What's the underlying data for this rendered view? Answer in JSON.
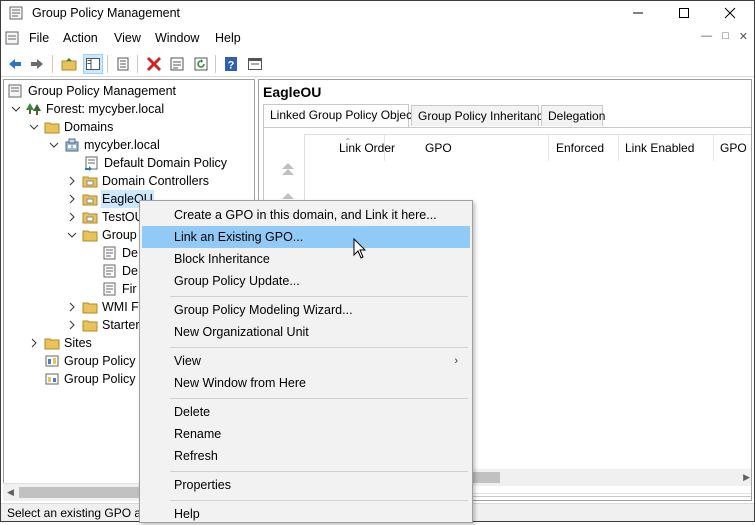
{
  "window": {
    "title": "Group Policy Management",
    "controls": [
      "minimize",
      "maximize",
      "close"
    ]
  },
  "menubar": {
    "items": [
      "File",
      "Action",
      "View",
      "Window",
      "Help"
    ]
  },
  "toolbar": {
    "icons": [
      "back-icon",
      "forward-icon",
      "up-folder-icon",
      "show-hide-tree-icon",
      "properties-icon",
      "delete-icon",
      "export-list-icon",
      "refresh-icon",
      "help-icon",
      "console-icon"
    ]
  },
  "tree": {
    "root": "Group Policy Management",
    "forest": "Forest: mycyber.local",
    "domains": "Domains",
    "domain": "mycyber.local",
    "default_domain_policy": "Default Domain Policy",
    "domain_controllers": "Domain Controllers",
    "eagle_ou": "EagleOU",
    "test_ou": "TestOU",
    "group_policy_objects": "Group",
    "gpo_child_1": "De",
    "gpo_child_2": "De",
    "gpo_child_3": "Fir",
    "wmi_filters": "WMI F",
    "starter_gpos": "Starter",
    "sites": "Sites",
    "gp_modeling": "Group Policy",
    "gp_results": "Group Policy"
  },
  "right_pane": {
    "title": "EagleOU",
    "tabs": [
      "Linked Group Policy Objects",
      "Group Policy Inheritance",
      "Delegation"
    ],
    "active_tab": 0,
    "columns": [
      "Link Order",
      "GPO",
      "Enforced",
      "Link Enabled",
      "GPO"
    ]
  },
  "context_menu": {
    "items": [
      {
        "label": "Create a GPO in this domain, and Link it here...",
        "hover": false
      },
      {
        "label": "Link an Existing GPO...",
        "hover": true
      },
      {
        "label": "Block Inheritance",
        "hover": false
      },
      {
        "label": "Group Policy Update...",
        "hover": false
      },
      {
        "label": "Group Policy Modeling Wizard...",
        "hover": false
      },
      {
        "label": "New Organizational Unit",
        "hover": false
      },
      {
        "label": "View",
        "hover": false,
        "submenu": true
      },
      {
        "label": "New Window from Here",
        "hover": false
      },
      {
        "label": "Delete",
        "hover": false
      },
      {
        "label": "Rename",
        "hover": false
      },
      {
        "label": "Refresh",
        "hover": false
      },
      {
        "label": "Properties",
        "hover": false
      },
      {
        "label": "Help",
        "hover": false
      }
    ]
  },
  "statusbar": {
    "text": "Select an existing GPO an"
  },
  "colors": {
    "selection": "#cce8ff",
    "menu_hover": "#91c9f7",
    "folder": "#e8c35a"
  }
}
